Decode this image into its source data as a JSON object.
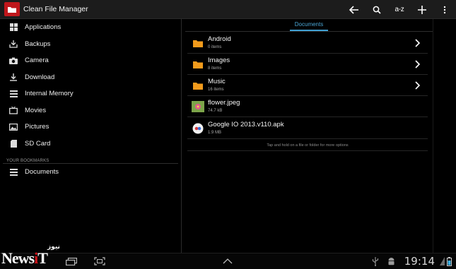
{
  "app": {
    "title": "Clean File Manager"
  },
  "actionbar": {
    "sort_label": "a-z"
  },
  "sidebar": {
    "items": [
      {
        "label": "Applications",
        "icon": "grid-icon"
      },
      {
        "label": "Backups",
        "icon": "download-tray-icon"
      },
      {
        "label": "Camera",
        "icon": "camera-icon"
      },
      {
        "label": "Download",
        "icon": "download-icon"
      },
      {
        "label": "Internal Memory",
        "icon": "list-icon"
      },
      {
        "label": "Movies",
        "icon": "tv-icon"
      },
      {
        "label": "Pictures",
        "icon": "picture-icon"
      },
      {
        "label": "SD Card",
        "icon": "sdcard-icon"
      }
    ],
    "bookmarks_header": "YOUR BOOKMARKS",
    "bookmarks": [
      {
        "label": "Documents",
        "icon": "list-icon"
      }
    ]
  },
  "main": {
    "tab_label": "Documents",
    "files": [
      {
        "name": "Android",
        "sub": "0 items",
        "type": "folder"
      },
      {
        "name": "Images",
        "sub": "8 items",
        "type": "folder"
      },
      {
        "name": "Music",
        "sub": "16 items",
        "type": "folder"
      },
      {
        "name": "flower.jpeg",
        "sub": "74.7 kB",
        "type": "image"
      },
      {
        "name": "Google IO 2013.v110.apk",
        "sub": "1.9 MB",
        "type": "apk"
      }
    ],
    "hint": "Tap and hold on a file or folder for more options"
  },
  "statusbar": {
    "time": "19:14"
  },
  "watermark": {
    "text_a": "News",
    "text_b": "i",
    "text_c": "T",
    "text_fa": "نیوز"
  },
  "colors": {
    "accent": "#3f9fd1",
    "folder": "#f29b1c",
    "app_red": "#c0171c"
  }
}
